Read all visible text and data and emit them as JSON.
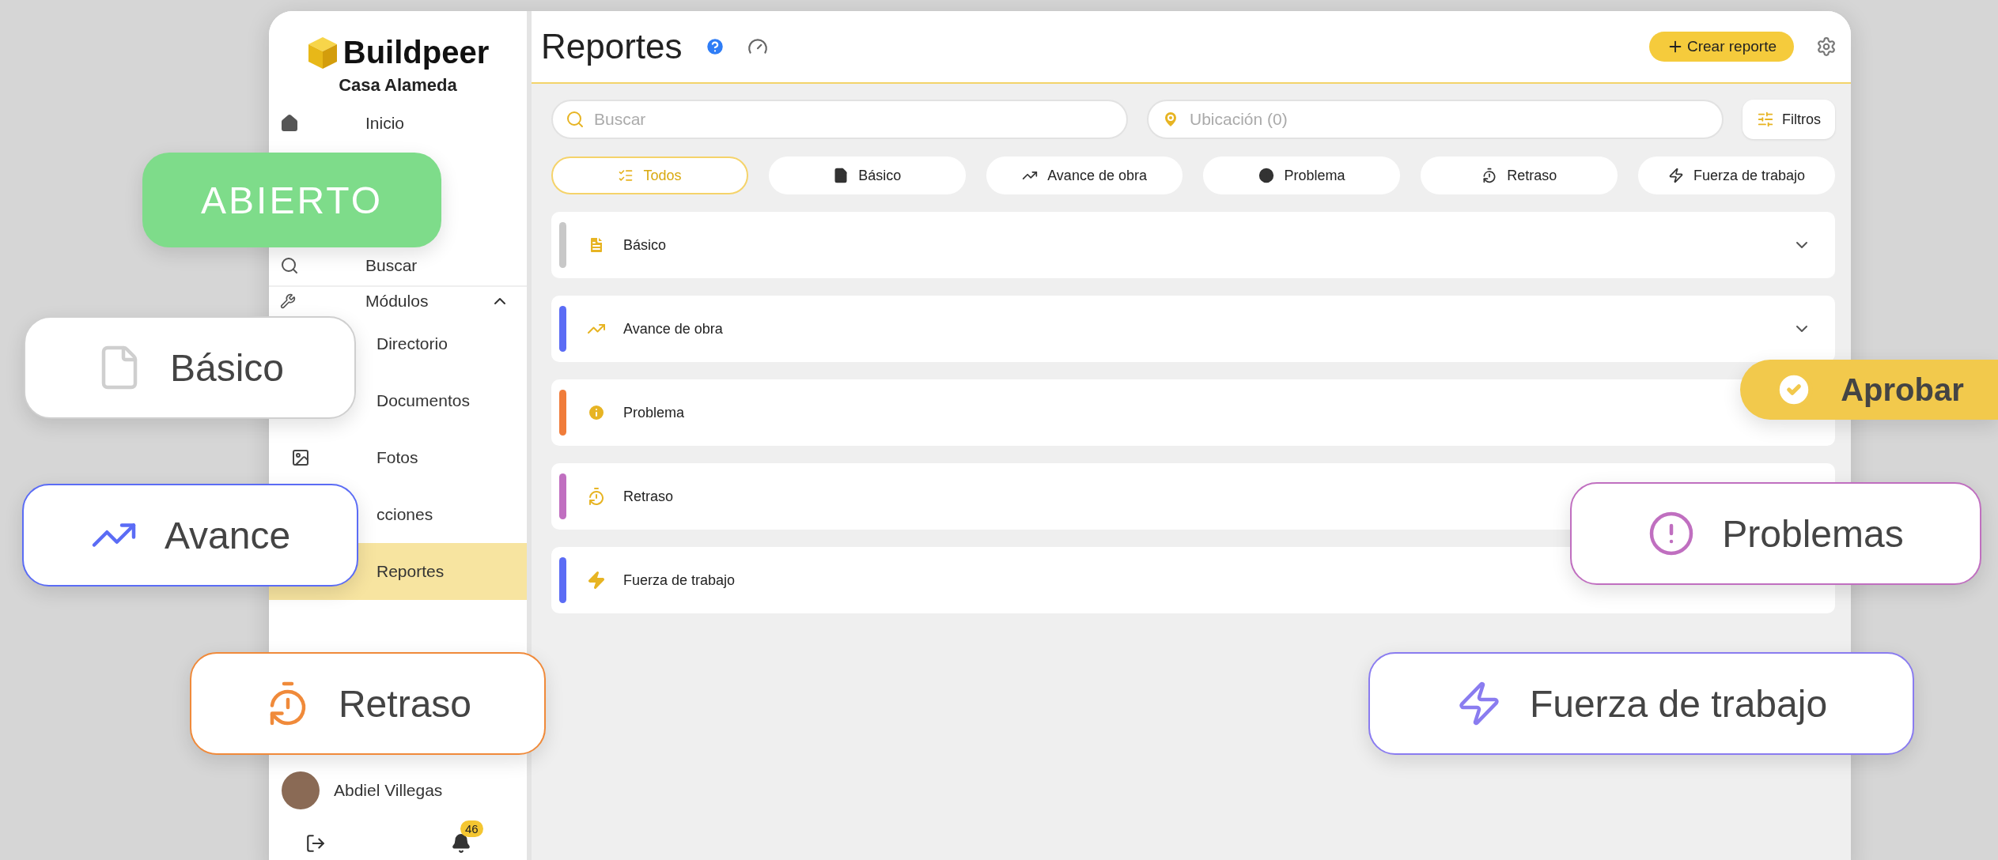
{
  "sidebar": {
    "logo": "Buildpeer",
    "project": "Casa Alameda",
    "top_items": [
      {
        "label": "Inicio",
        "selected": false
      },
      {
        "label": "Buscar",
        "selected": false
      }
    ],
    "modules": {
      "label": "Módulos",
      "expanded": true,
      "children": [
        {
          "label": "Directorio",
          "selected": false
        },
        {
          "label": "Documentos",
          "selected": false
        },
        {
          "label": "Fotos",
          "selected": false
        },
        {
          "label": "cciones",
          "selected": false
        },
        {
          "label": "Reportes",
          "selected": true
        }
      ]
    },
    "user": {
      "name": "Abdiel Villegas"
    },
    "notifications": {
      "count": "46"
    }
  },
  "header": {
    "title": "Reportes",
    "create_button": "Crear reporte"
  },
  "search": {
    "placeholder": "Buscar"
  },
  "location": {
    "placeholder": "Ubicación (0)"
  },
  "filters_button": "Filtros",
  "type_tabs": [
    {
      "label": "Todos",
      "selected": true
    },
    {
      "label": "Básico",
      "selected": false
    },
    {
      "label": "Avance de obra",
      "selected": false
    },
    {
      "label": "Problema",
      "selected": false
    },
    {
      "label": "Retraso",
      "selected": false
    },
    {
      "label": "Fuerza de trabajo",
      "selected": false
    }
  ],
  "report_groups": [
    {
      "label": "Básico",
      "color": "#c8c8c8",
      "expandable": true
    },
    {
      "label": "Avance de obra",
      "color": "#5b6cf5",
      "expandable": true
    },
    {
      "label": "Problema",
      "color": "#f07c3a",
      "expandable": false
    },
    {
      "label": "Retraso",
      "color": "#c06fc0",
      "expandable": false
    },
    {
      "label": "Fuerza de trabajo",
      "color": "#5b6cf5",
      "expandable": false
    }
  ],
  "floating_badges": [
    {
      "kind": "status",
      "label": "ABIERTO",
      "color": "#7edc8a"
    },
    {
      "kind": "pill",
      "label": "Básico",
      "color": "#cfcfcf"
    },
    {
      "kind": "pill",
      "label": "Avance",
      "color": "#5b6cf5"
    },
    {
      "kind": "pill",
      "label": "Retraso",
      "color": "#f08a3a"
    },
    {
      "kind": "action",
      "label": "Aprobar",
      "color": "#f2c94c"
    },
    {
      "kind": "pill",
      "label": "Problemas",
      "color": "#c06fc0"
    },
    {
      "kind": "pill",
      "label": "Fuerza de trabajo",
      "color": "#8a7cf0"
    }
  ]
}
